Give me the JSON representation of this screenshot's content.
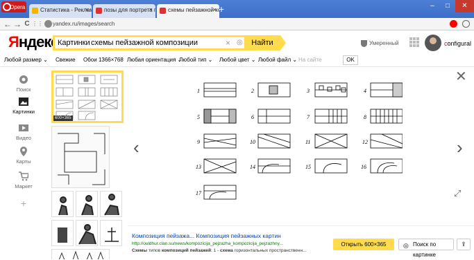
{
  "browser": {
    "logo_label": "Opera",
    "tabs": [
      {
        "label": "Статистика - Рекламная с...",
        "icon_color": "#f5b400",
        "active": false
      },
      {
        "label": "позы для портрета по пл...",
        "icon_color": "#e03030",
        "active": false
      },
      {
        "label": "схемы пейзажной компо...",
        "icon_color": "#e03030",
        "active": true
      }
    ],
    "new_tab": "+",
    "tab_close": "×",
    "window_controls": {
      "minimize": "‒",
      "maximize": "□",
      "close": "✕"
    },
    "url": "yandex.ru/images/search",
    "nav": {
      "back": "←",
      "forward": "→",
      "reload": "C",
      "menu": "⋮⋮"
    }
  },
  "header": {
    "logo_red": "Я",
    "logo_rest": "ндекс",
    "search_crumb": "Картинки",
    "search_query": "схемы пейзажной композиции",
    "search_button": "Найти",
    "clear": "×",
    "safe_search": "Умеренный",
    "user": {
      "first": "c",
      "rest": "onfigural"
    }
  },
  "filters": [
    {
      "label": "Любой размер ⌄",
      "dim": false
    },
    {
      "label": "Свежие",
      "dim": false
    },
    {
      "label": "Обои 1366×768",
      "dim": false
    },
    {
      "label": "Любая ориентация ⌄",
      "dim": false
    },
    {
      "label": "Любой тип ⌄",
      "dim": false
    },
    {
      "label": "Любой цвет ⌄",
      "dim": false
    },
    {
      "label": "Любой файл ⌄",
      "dim": false
    },
    {
      "label": "На сайте",
      "dim": true
    }
  ],
  "filters_ok": "OK",
  "left_nav": [
    {
      "label": "Поиск",
      "icon": "search-icon",
      "active": false
    },
    {
      "label": "Картинки",
      "icon": "image-icon",
      "active": true
    },
    {
      "label": "Видео",
      "icon": "video-icon",
      "active": false
    },
    {
      "label": "Карты",
      "icon": "map-pin-icon",
      "active": false
    },
    {
      "label": "Маркет",
      "icon": "cart-icon",
      "active": false
    },
    {
      "label": "+",
      "icon": "plus-icon",
      "active": false
    }
  ],
  "thumbnail_label": "600×365",
  "diagram_numbers": [
    "1",
    "2",
    "3",
    "4",
    "5",
    "6",
    "7",
    "8",
    "9",
    "10",
    "11",
    "12",
    "13",
    "14",
    "15",
    "16",
    "17"
  ],
  "caption": {
    "title": "Композиция пейзажа... Композиция пейзажных картин",
    "url": "http://ouldhur.clan.su/news/kompozicija_pejzazha_kompozicija_pejzazhny...",
    "desc_prefix": "Схемы",
    "desc_mid1": " типов ",
    "desc_bold": "композиций пейзажей",
    "desc_mid2": ": 1 - ",
    "desc_bold2": "схема",
    "desc_suffix": " горизонтальных пространственн..."
  },
  "actions": {
    "open": "Открыть 600×365",
    "similar": "Поиск по картинке",
    "share": "⇪"
  },
  "colors": {
    "yandex_yellow": "#ffdb4d",
    "yandex_red": "#ff0000",
    "link": "#0044bb",
    "url_green": "#007700"
  }
}
